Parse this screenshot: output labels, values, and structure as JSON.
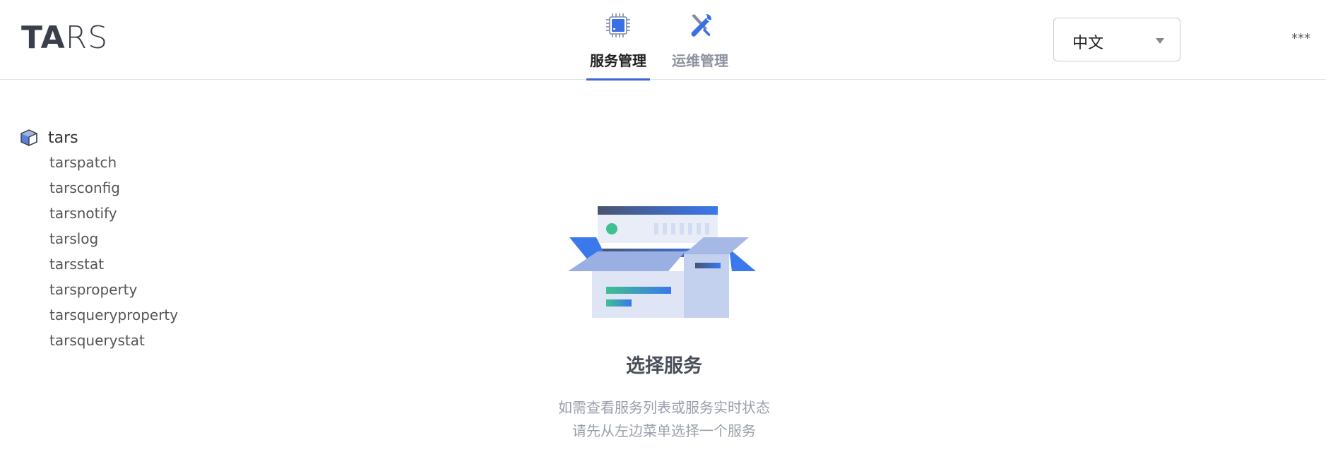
{
  "header": {
    "logo": {
      "bold": "TA",
      "thin": "RS"
    },
    "tabs": [
      {
        "label": "服务管理",
        "icon": "chip-icon",
        "active": true
      },
      {
        "label": "运维管理",
        "icon": "tools-icon",
        "active": false
      }
    ],
    "language": {
      "selected": "中文"
    },
    "user": "***"
  },
  "sidebar": {
    "root": {
      "label": "tars",
      "icon": "cube-icon"
    },
    "items": [
      "tarspatch",
      "tarsconfig",
      "tarsnotify",
      "tarslog",
      "tarsstat",
      "tarsproperty",
      "tarsqueryproperty",
      "tarsquerystat"
    ]
  },
  "main": {
    "empty_state": {
      "illustration": "open-box-illustration",
      "title": "选择服务",
      "desc_line1": "如需查看服务列表或服务实时状态",
      "desc_line2": "请先从左边菜单选择一个服务"
    }
  },
  "colors": {
    "accent": "#3a66d8",
    "tab_inactive": "#8d929e",
    "muted_text": "#9aa0ab"
  }
}
